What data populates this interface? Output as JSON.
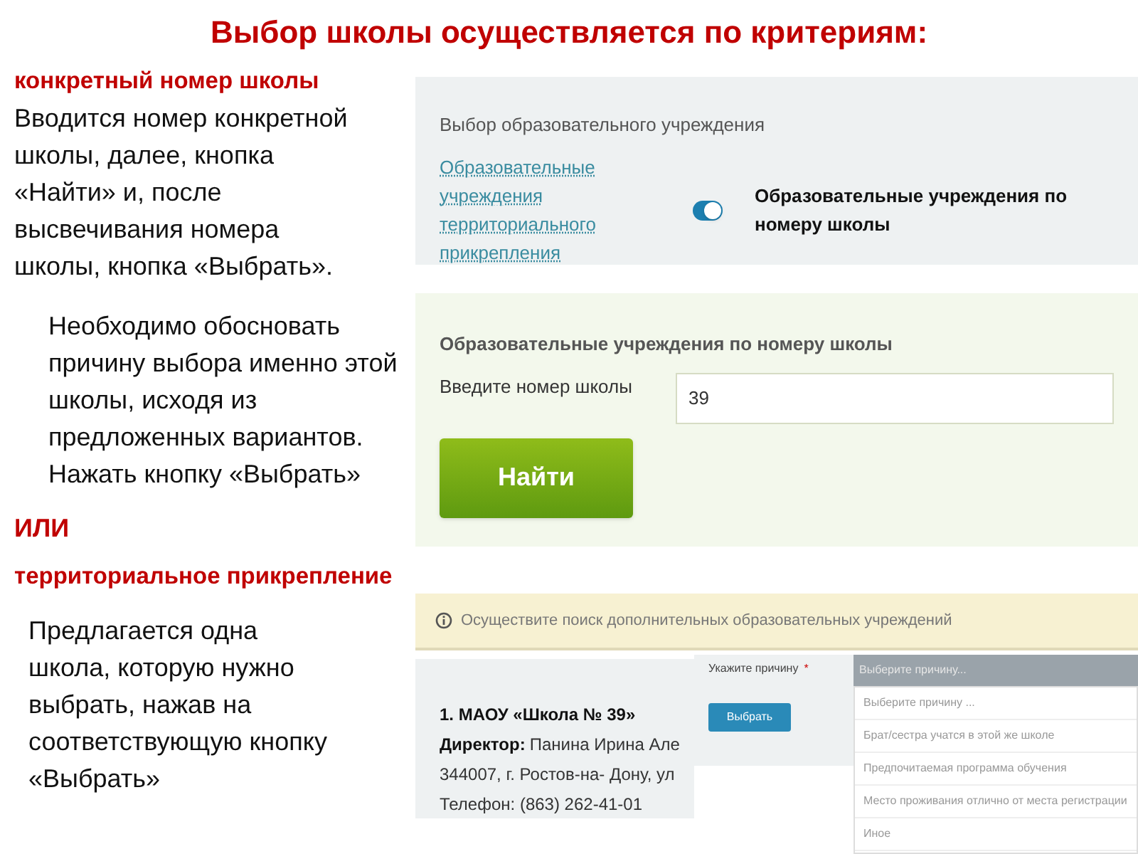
{
  "title": "Выбор школы осуществляется по критериям:",
  "notes": [
    {
      "kind": "heading",
      "text": "конкретный номер школы"
    },
    {
      "kind": "paragraph",
      "text": "Вводится номер конкретной школы, далее, кнопка «Найти» и, после высвечивания номера школы, кнопка «Выбрать»."
    },
    {
      "kind": "indented",
      "text": "Необходимо обосновать причину выбора именно этой школы, исходя из предложенных вариантов. Нажать кнопку «Выбрать»"
    },
    {
      "kind": "heading",
      "text": "ИЛИ"
    },
    {
      "kind": "heading",
      "text": "территориальное прикрепление"
    },
    {
      "kind": "paragraph",
      "text": "Предлагается одна школа, которую нужно выбрать, нажав на соответствующую кнопку «Выбрать»"
    }
  ],
  "selection_panel": {
    "title": "Выбор образовательного учреждения",
    "left_option": "Образовательные учреждения территориального прикрепления",
    "toggle": {
      "on": true
    },
    "right_option": "Образовательные учреждения по номеру школы"
  },
  "search_panel": {
    "title": "Образовательные учреждения по номеру школы",
    "label": "Введите номер школы",
    "value": "39",
    "button": "Найти"
  },
  "info_bar": {
    "text": "Осуществите поиск дополнительных образовательных учреждений"
  },
  "school_card": {
    "name": "1. МАОУ «Школа № 39»",
    "director_label": "Директор:",
    "director": "Панина Ирина Але",
    "address": "344007, г. Ростов-на- Дону, ул",
    "phone": "Телефон: (863) 262-41-01"
  },
  "reason": {
    "label": "Укажите причину",
    "required_mark": "*",
    "button": "Выбрать",
    "placeholder": "Выберите причину...",
    "options": [
      {
        "text": "Выберите причину ..."
      },
      {
        "text": "Брат/сестра учатся в этой же школе"
      },
      {
        "text": "Предпочитаемая программа обучения"
      },
      {
        "text": "Место проживания отлично от места регистрации"
      },
      {
        "text": "Иное"
      }
    ]
  }
}
